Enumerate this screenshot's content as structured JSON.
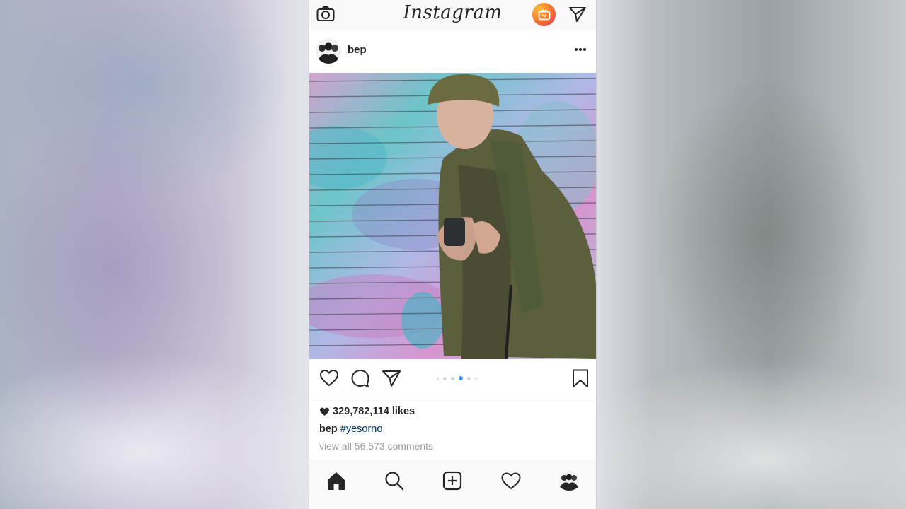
{
  "app": {
    "logo_text": "Instagram"
  },
  "post": {
    "username": "bep",
    "likes_count": "329,782,114 likes",
    "caption_user": "bep",
    "caption_hashtag": "#yesorno",
    "comments_link": "view all 56,573 comments",
    "carousel": {
      "total": 6,
      "active_index": 3
    }
  },
  "icons": {
    "top_left": "camera-icon",
    "top_right": "send-icon",
    "igtv": "igtv-icon",
    "actions": [
      "heart-icon",
      "comment-icon",
      "share-icon",
      "bookmark-icon"
    ],
    "nav": [
      "home-icon",
      "search-icon",
      "add-post-icon",
      "activity-heart-icon",
      "profile-avatar"
    ]
  },
  "colors": {
    "accent_blue": "#3897f0",
    "hashtag": "#003569",
    "muted_text": "#999999"
  }
}
